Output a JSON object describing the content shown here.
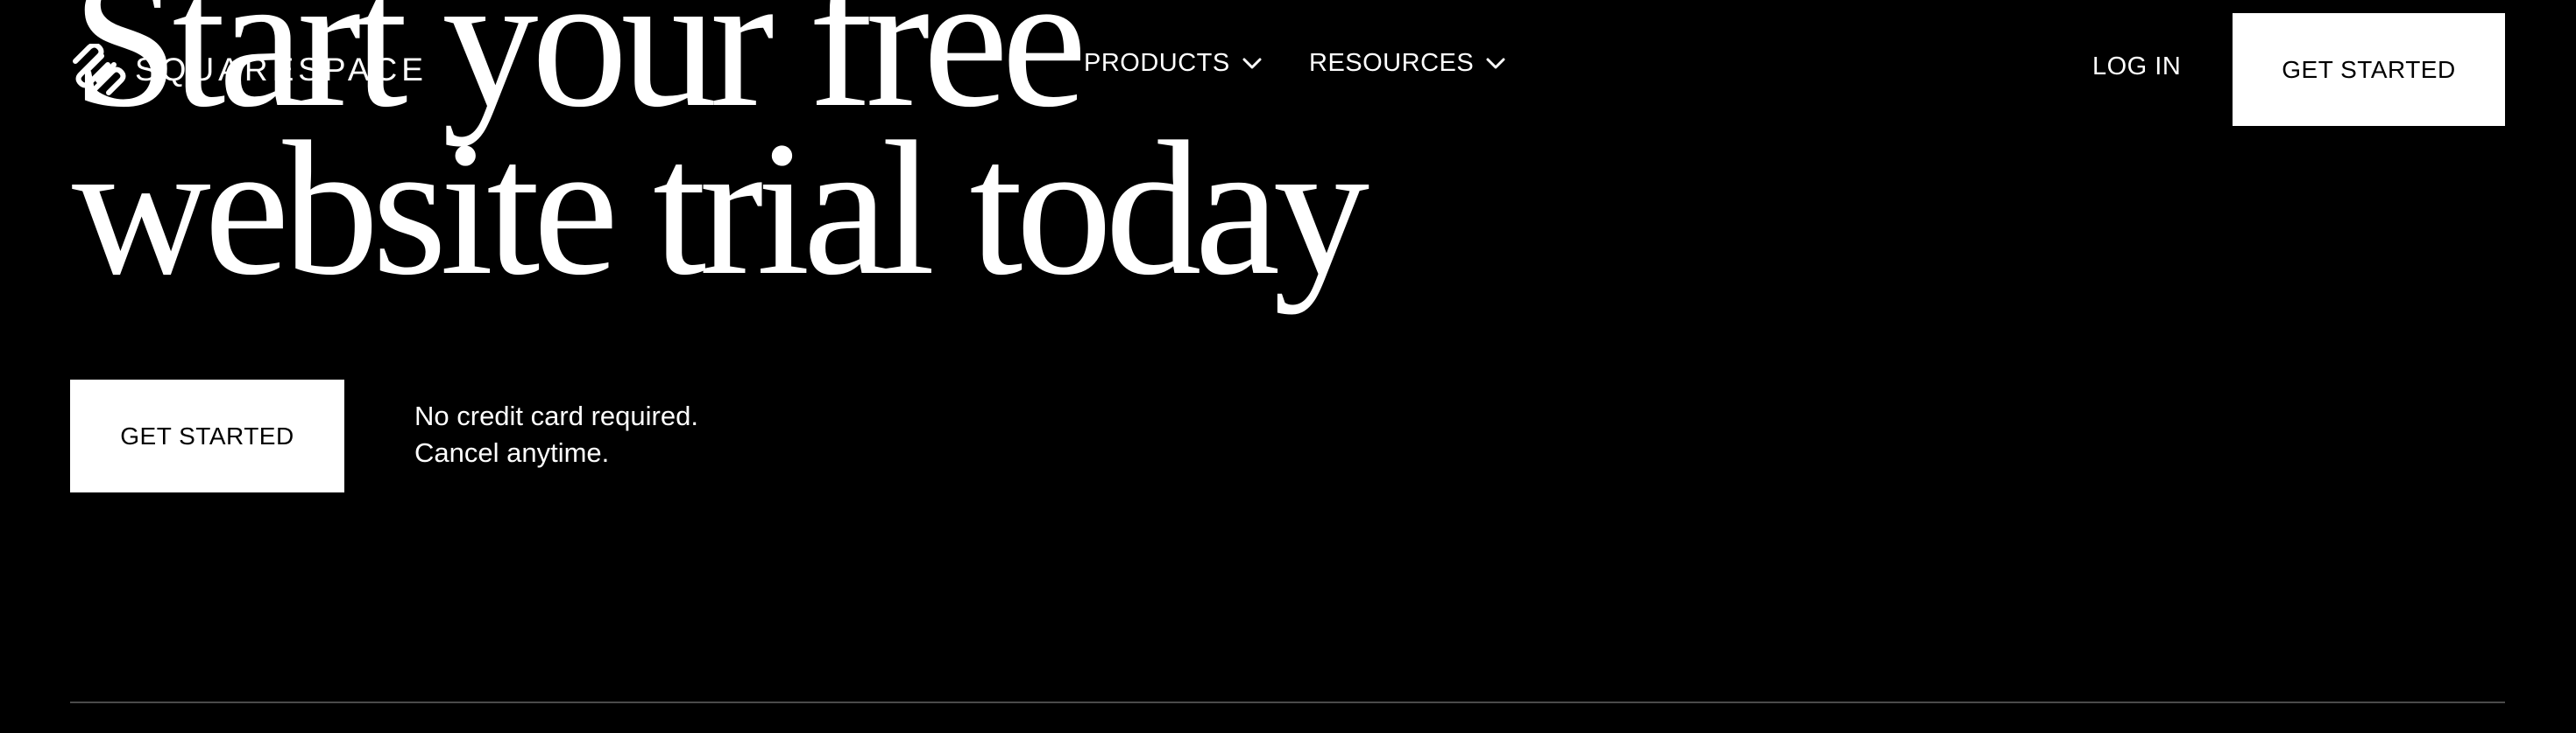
{
  "brand": {
    "name": "SQUARESPACE",
    "logo_icon": "squarespace-logo-icon"
  },
  "nav": {
    "products_label": "PRODUCTS",
    "resources_label": "RESOURCES",
    "dropdown_icon": "chevron-down-icon",
    "login_label": "LOG IN",
    "cta_label": "GET STARTED"
  },
  "hero": {
    "title_line_1": "Start your free",
    "title_line_2": "website trial today",
    "cta_label": "GET STARTED",
    "note_line_1": "No credit card required.",
    "note_line_2": "Cancel anytime."
  },
  "colors": {
    "background": "#000000",
    "text": "#ffffff",
    "button_background": "#ffffff",
    "button_text": "#000000",
    "divider": "#4a4a4a"
  }
}
